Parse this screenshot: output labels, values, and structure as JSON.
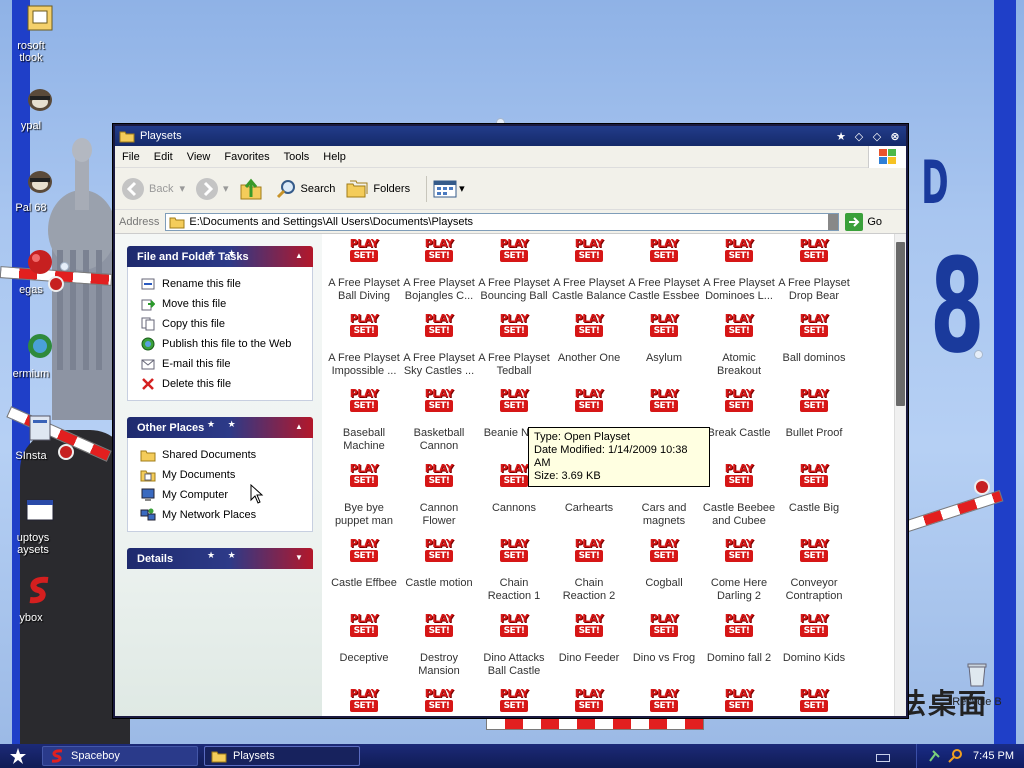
{
  "desktop": {
    "icons": [
      {
        "id": "outlook",
        "label": "rosoft\ntlook"
      },
      {
        "id": "playpal",
        "label": "ypal"
      },
      {
        "id": "playpal68",
        "label": "Pal 68"
      },
      {
        "id": "vegas",
        "label": "egas"
      },
      {
        "id": "vermium",
        "label": "ermium"
      },
      {
        "id": "sinstall",
        "label": "SInsta"
      },
      {
        "id": "playsets",
        "label": "uptoys\naysets"
      },
      {
        "id": "toybox",
        "label": "ybox"
      },
      {
        "id": "recycle",
        "label": "Recycle B"
      }
    ],
    "big_text_d": "D",
    "big_text_8": "8",
    "chinese_text": "法桌面"
  },
  "window": {
    "title": "Playsets",
    "menu": [
      "File",
      "Edit",
      "View",
      "Favorites",
      "Tools",
      "Help"
    ],
    "toolbar": {
      "back_label": "Back",
      "search_label": "Search",
      "folders_label": "Folders"
    },
    "address": {
      "label": "Address",
      "value": "E:\\Documents and Settings\\All Users\\Documents\\Playsets",
      "go_label": "Go"
    },
    "taskpane": {
      "file_tasks": {
        "title": "File and Folder Tasks",
        "items": [
          {
            "label": "Rename this file",
            "icon": "rename-icon"
          },
          {
            "label": "Move this file",
            "icon": "move-icon"
          },
          {
            "label": "Copy this file",
            "icon": "copy-icon"
          },
          {
            "label": "Publish this file to the Web",
            "icon": "web-icon"
          },
          {
            "label": "E-mail this file",
            "icon": "email-icon"
          },
          {
            "label": "Delete this file",
            "icon": "delete-icon"
          }
        ]
      },
      "other_places": {
        "title": "Other Places",
        "items": [
          {
            "label": "Shared Documents",
            "icon": "folder-icon"
          },
          {
            "label": "My Documents",
            "icon": "documents-icon"
          },
          {
            "label": "My Computer",
            "icon": "computer-icon"
          },
          {
            "label": "My Network Places",
            "icon": "network-icon"
          }
        ]
      },
      "details": {
        "title": "Details"
      }
    },
    "files": [
      "A Free Playset Ball Diving",
      "A Free Playset Bojangles C...",
      "A Free Playset Bouncing Ball",
      "A Free Playset Castle Balance",
      "A Free Playset Castle Essbee",
      "A Free Playset Dominoes L...",
      "A Free Playset Drop Bear",
      "A Free Playset Impossible ...",
      "A Free Playset Sky Castles ...",
      "A Free Playset Tedball",
      "Another One",
      "Asylum",
      "Atomic Breakout",
      "Ball dominos",
      "Baseball Machine",
      "Basketball Cannon",
      "Beanie Nu...",
      "",
      "",
      "Break Castle",
      "Bullet Proof",
      "Bye bye puppet man",
      "Cannon Flower",
      "Cannons",
      "Carhearts",
      "Cars and magnets",
      "Castle Beebee and Cubee",
      "Castle Big",
      "Castle Effbee",
      "Castle motion",
      "Chain Reaction 1",
      "Chain Reaction 2",
      "Cogball",
      "Come Here Darling 2",
      "Conveyor Contraption",
      "Deceptive",
      "Destroy Mansion",
      "Dino Attacks Ball Castle",
      "Dino Feeder",
      "Dino vs Frog",
      "Domino fall 2",
      "Domino Kids",
      "",
      "",
      "",
      "",
      "",
      "",
      ""
    ],
    "badge": {
      "play": "PLAY",
      "set": "SET!"
    },
    "tooltip": {
      "type": "Type: Open Playset",
      "modified": "Date Modified: 1/14/2009 10:38 AM",
      "size": "Size: 3.69 KB"
    }
  },
  "taskbar": {
    "buttons": [
      {
        "label": "Spaceboy",
        "active": false
      },
      {
        "label": "Playsets",
        "active": true
      }
    ],
    "clock": "7:45 PM"
  },
  "colors": {
    "panel_blue": "#1e2a6e",
    "panel_red": "#b3172a",
    "badge_red": "#d61616",
    "tooltip_bg": "#ffffe1"
  }
}
